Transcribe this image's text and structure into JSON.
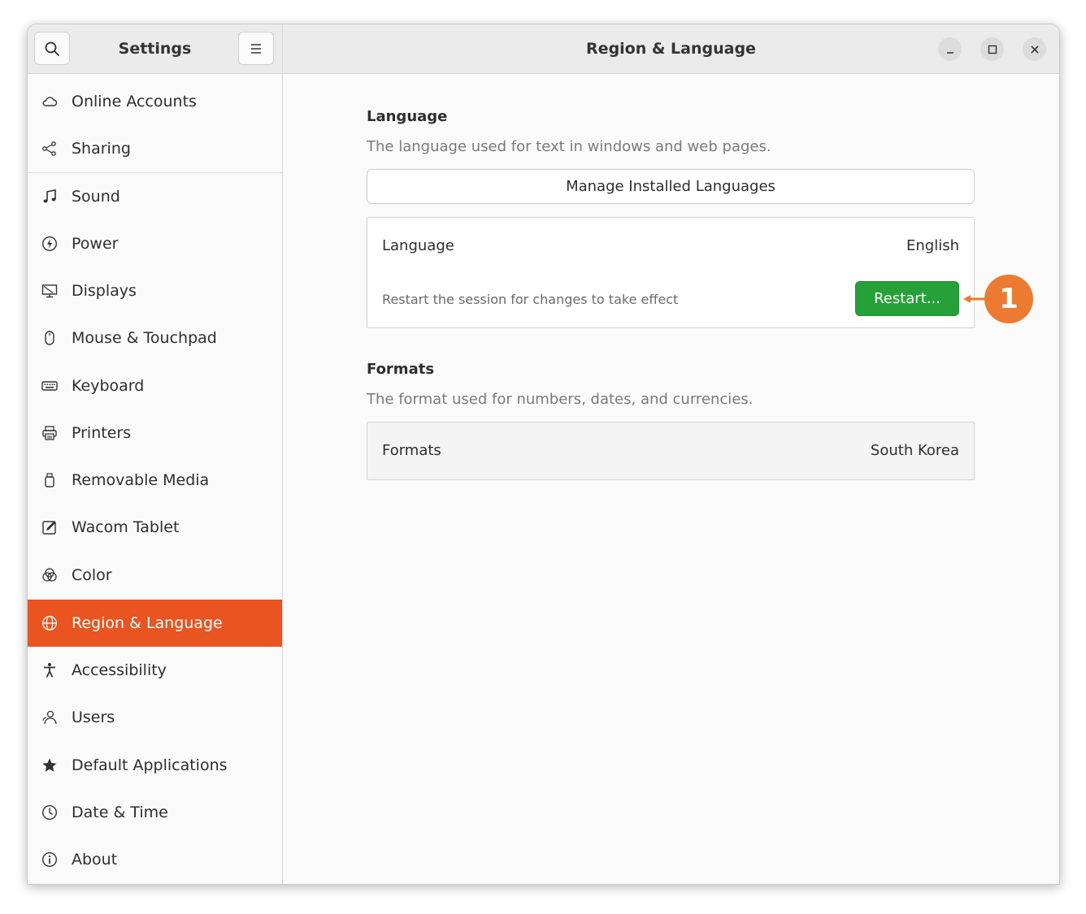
{
  "sidebar_header": {
    "title": "Settings"
  },
  "main_header": {
    "title": "Region & Language"
  },
  "sidebar": {
    "items": [
      {
        "label": "Online Accounts",
        "icon": "cloud-icon"
      },
      {
        "label": "Sharing",
        "icon": "share-icon"
      },
      {
        "label": "Sound",
        "icon": "music-note-icon"
      },
      {
        "label": "Power",
        "icon": "power-icon"
      },
      {
        "label": "Displays",
        "icon": "display-icon"
      },
      {
        "label": "Mouse & Touchpad",
        "icon": "mouse-icon"
      },
      {
        "label": "Keyboard",
        "icon": "keyboard-icon"
      },
      {
        "label": "Printers",
        "icon": "printer-icon"
      },
      {
        "label": "Removable Media",
        "icon": "usb-drive-icon"
      },
      {
        "label": "Wacom Tablet",
        "icon": "tablet-pen-icon"
      },
      {
        "label": "Color",
        "icon": "color-circles-icon"
      },
      {
        "label": "Region & Language",
        "icon": "globe-icon",
        "active": true
      },
      {
        "label": "Accessibility",
        "icon": "accessibility-icon"
      },
      {
        "label": "Users",
        "icon": "users-icon"
      },
      {
        "label": "Default Applications",
        "icon": "star-icon"
      },
      {
        "label": "Date & Time",
        "icon": "clock-icon"
      },
      {
        "label": "About",
        "icon": "info-icon"
      }
    ]
  },
  "language_section": {
    "title": "Language",
    "description": "The language used for text in windows and web pages.",
    "manage_button": "Manage Installed Languages",
    "row_label": "Language",
    "row_value": "English",
    "hint": "Restart the session for changes to take effect",
    "restart_button": "Restart..."
  },
  "formats_section": {
    "title": "Formats",
    "description": "The format used for numbers, dates, and currencies.",
    "row_label": "Formats",
    "row_value": "South Korea"
  },
  "callout": {
    "number": "1"
  },
  "colors": {
    "accent": "#e95420",
    "restart": "#26a13a",
    "callout": "#ec7a30"
  }
}
